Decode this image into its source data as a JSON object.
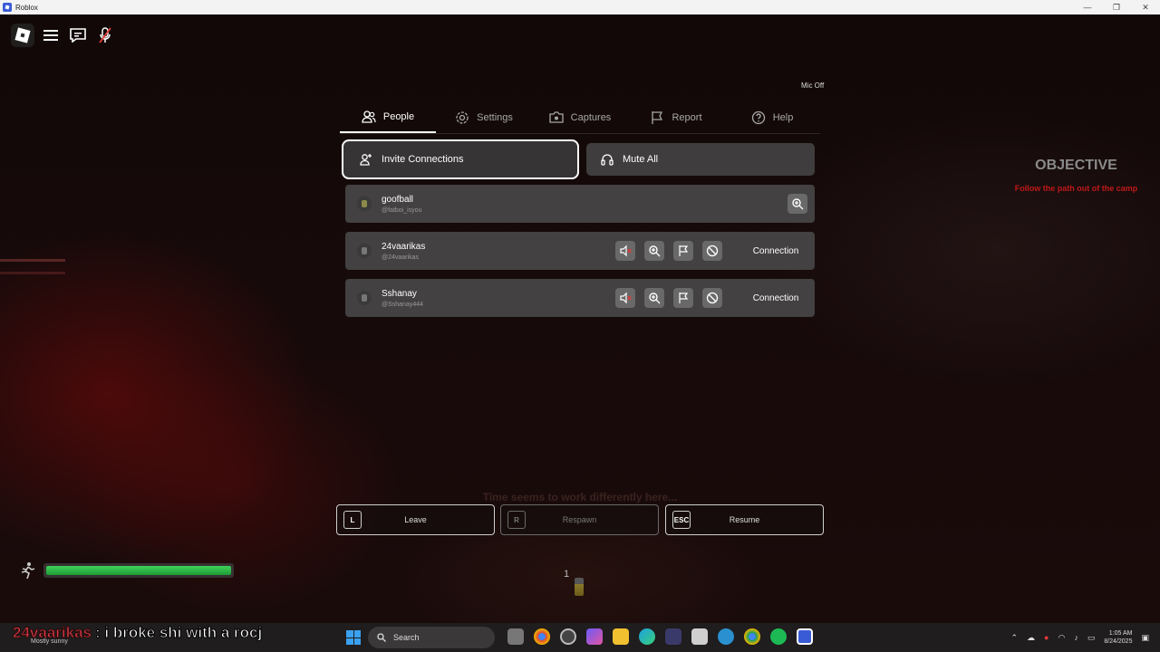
{
  "window": {
    "title": "Roblox",
    "controls": [
      "—",
      "❐",
      "✕"
    ]
  },
  "hud": {
    "mic_status": "Mic Off"
  },
  "tabs": [
    {
      "label": "People",
      "icon": "people-icon",
      "active": true
    },
    {
      "label": "Settings",
      "icon": "gear-icon",
      "active": false
    },
    {
      "label": "Captures",
      "icon": "camera-icon",
      "active": false
    },
    {
      "label": "Report",
      "icon": "flag-icon",
      "active": false
    },
    {
      "label": "Help",
      "icon": "help-icon",
      "active": false
    }
  ],
  "actions": {
    "invite_label": "Invite Connections",
    "mute_label": "Mute All"
  },
  "players": [
    {
      "display_name": "goofball",
      "username": "@fatboi_isyou",
      "is_self": true
    },
    {
      "display_name": "24vaarikas",
      "username": "@24vaarikas",
      "is_self": false,
      "connection_label": "Connection"
    },
    {
      "display_name": "Sshanay",
      "username": "@Sshanay444",
      "is_self": false,
      "connection_label": "Connection"
    }
  ],
  "objective": {
    "title": "OBJECTIVE",
    "text": "Follow the path out of the camp"
  },
  "game_hint": "Time seems to work differently here...",
  "bottom_buttons": [
    {
      "key": "L",
      "label": "Leave",
      "enabled": true
    },
    {
      "key": "R",
      "label": "Respawn",
      "enabled": false
    },
    {
      "key": "ESC",
      "label": "Resume",
      "enabled": true
    }
  ],
  "stamina": {
    "level": 1.0,
    "color": "#2fbf4a"
  },
  "hotbar": {
    "slot_number": "1"
  },
  "caption": {
    "user": "24vaarikas",
    "message": ": i broke shi with a rocj"
  },
  "taskbar": {
    "weather": "Mostly sunny",
    "search_label": "Search",
    "time": "1:05 AM",
    "date": "8/24/2025"
  },
  "colors": {
    "accent_red": "#c01818",
    "panel": "#4b4b4b",
    "stamina_green": "#2fbf4a"
  }
}
